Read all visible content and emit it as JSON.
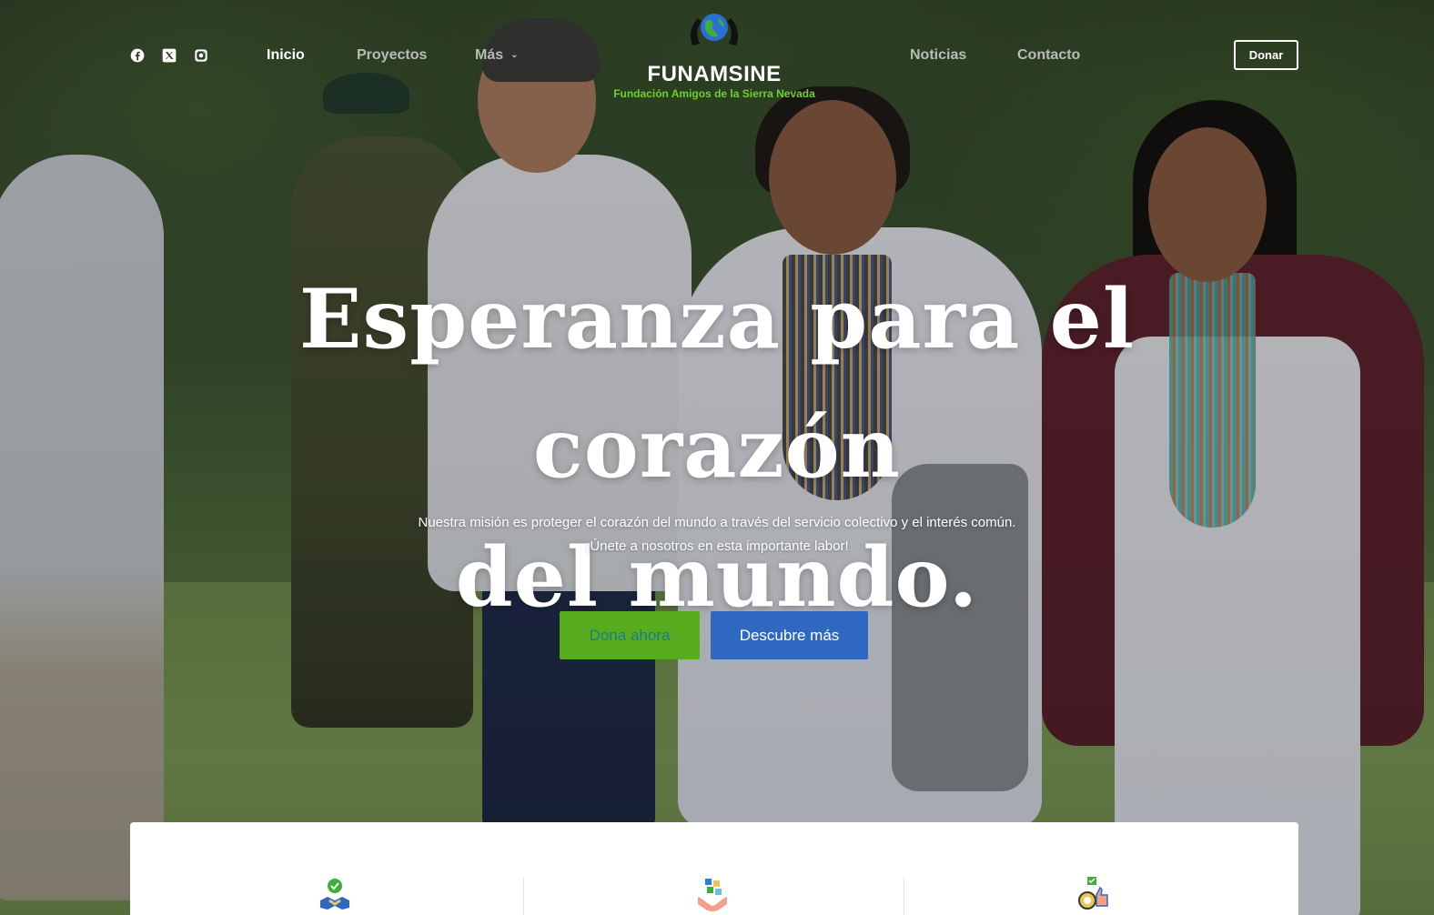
{
  "social": {
    "facebook": "facebook-icon",
    "x": "x-twitter-icon",
    "instagram": "instagram-icon"
  },
  "nav": {
    "inicio": "Inicio",
    "proyectos": "Proyectos",
    "mas": "Más",
    "noticias": "Noticias",
    "contacto": "Contacto"
  },
  "logo": {
    "title": "FUNAMSINE",
    "subtitle": "Fundación Amigos de la Sierra Nevada"
  },
  "header": {
    "donate_label": "Donar"
  },
  "hero": {
    "headline_line1": "Esperanza para el corazón",
    "headline_line2": "del mundo.",
    "mission_line1": "Nuestra misión es proteger el corazón del mundo a través del servicio colectivo y el interés común.",
    "mission_line2": "¡Únete a nosotros en esta importante labor!",
    "primary_button": "Dona ahora",
    "secondary_button": "Descubre más"
  },
  "features": {
    "icons": [
      "handshake-icon",
      "puzzle-hands-icon",
      "award-thumbs-up-icon"
    ]
  },
  "colors": {
    "accent_green": "#58ad1f",
    "accent_blue": "#2f68c0",
    "subtitle_green": "#6bd12f"
  }
}
